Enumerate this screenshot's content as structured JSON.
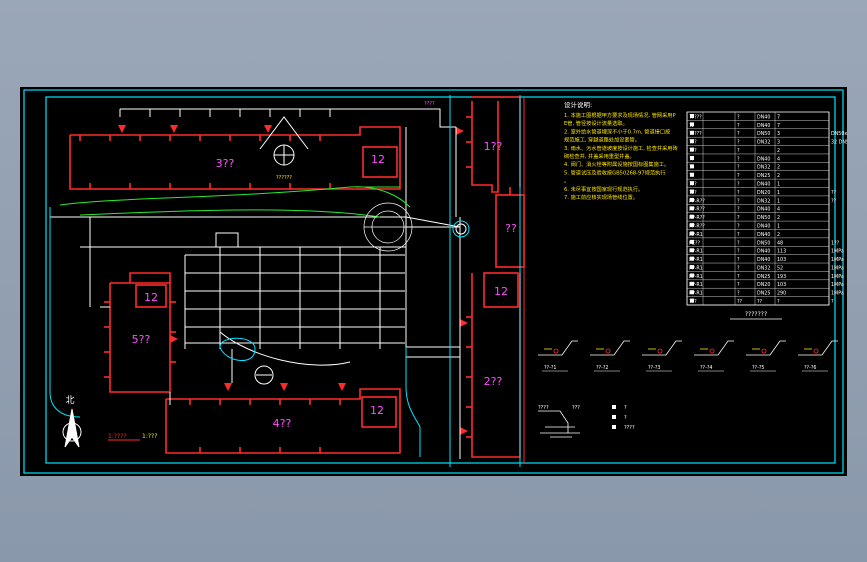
{
  "building_labels": {
    "b3": "3??",
    "b1": "1??",
    "b5": "5??",
    "b2": "2??",
    "b4": "4??",
    "center": "??",
    "n12_a": "12",
    "n12_b": "12",
    "n12_c": "12",
    "n12_d": "12"
  },
  "drawing": {
    "north_label": "北",
    "scale_label": "1:????",
    "scale_sub": "1:???",
    "small_title": "???????",
    "small_label_left": "???",
    "small_label_top": "????",
    "legend_title": "????????"
  },
  "notes": {
    "title": "设计说明:",
    "lines": [
      "1. 本施工图根据甲方要求及现场情况, 管网采用PE管, 管径按设计流量选取。",
      "2. 室外给水管道埋深不小于0.7m, 管道接口按规范施工, 穿越道路处加设套管。",
      "3. 雨水、污水管道坡度按设计施工, 检查井采用砖砌检查井, 井盖采用重型井盖。",
      "4. 阀门、消火栓等附属设施按国标图集施工。",
      "5. 管道试压及验收按GB50268-97规范执行。",
      "6. 未尽事宜按国家现行规范执行。",
      "7. 施工前应核实现场管线位置。"
    ]
  },
  "table_rows": [
    [
      "?????",
      "?",
      "DN40",
      "7",
      ""
    ],
    [
      "??",
      "?",
      "DN40",
      "7",
      ""
    ],
    [
      "?????",
      "?",
      "DN50",
      "3",
      "DN50x40"
    ],
    [
      "???",
      "?",
      "DN32",
      "3",
      "32 DN50/1-2"
    ],
    [
      "???",
      "?",
      "",
      "2",
      ""
    ],
    [
      "??",
      "?",
      "DN40",
      "4",
      ""
    ],
    [
      "??",
      "?",
      "DN32",
      "2",
      ""
    ],
    [
      "??",
      "?",
      "DN25",
      "2",
      ""
    ],
    [
      "???",
      "?",
      "DN40",
      "1",
      ""
    ],
    [
      "???",
      "?",
      "DN20",
      "1",
      "??"
    ],
    [
      "PP-R??",
      "?",
      "DN32",
      "1",
      "??"
    ],
    [
      "PP-R??",
      "?",
      "DN40",
      "4",
      ""
    ],
    [
      "PP-R??",
      "?",
      "DN50",
      "2",
      ""
    ],
    [
      "PP-R??",
      "?",
      "DN40",
      "1",
      ""
    ],
    [
      "PP-R1",
      "?",
      "DN40",
      "2",
      ""
    ],
    [
      "PE??",
      "?",
      "DN50",
      "48",
      "1??"
    ],
    [
      "PP-R1",
      "?",
      "DN40",
      "113",
      "1MPa"
    ],
    [
      "PP-R1",
      "?",
      "DN40",
      "103",
      "1MPa"
    ],
    [
      "PP-R1",
      "?",
      "DN32",
      "52",
      "1MPa"
    ],
    [
      "PP-R1",
      "?",
      "DN25",
      "193",
      "1MPa"
    ],
    [
      "PP-R1",
      "?",
      "DN20",
      "103",
      "1MPa"
    ],
    [
      "PP-R1",
      "?",
      "DN25",
      "290",
      "1MPa"
    ],
    [
      "???",
      "??",
      "??",
      "?",
      "?"
    ]
  ],
  "detail_labels": [
    "??-?1",
    "??-?2",
    "??-?3",
    "??-?4",
    "??-?5",
    "??-?6"
  ],
  "legend_items": [
    "?",
    "?",
    "????"
  ],
  "colors": {
    "frame": "#00e5ff",
    "building": "#ff2a2a",
    "pipe": "#ffffff",
    "pipe_green": "#2ee82e",
    "text_magenta": "#ff4dff",
    "text_yellow": "#ffe600",
    "background": "#000000"
  }
}
